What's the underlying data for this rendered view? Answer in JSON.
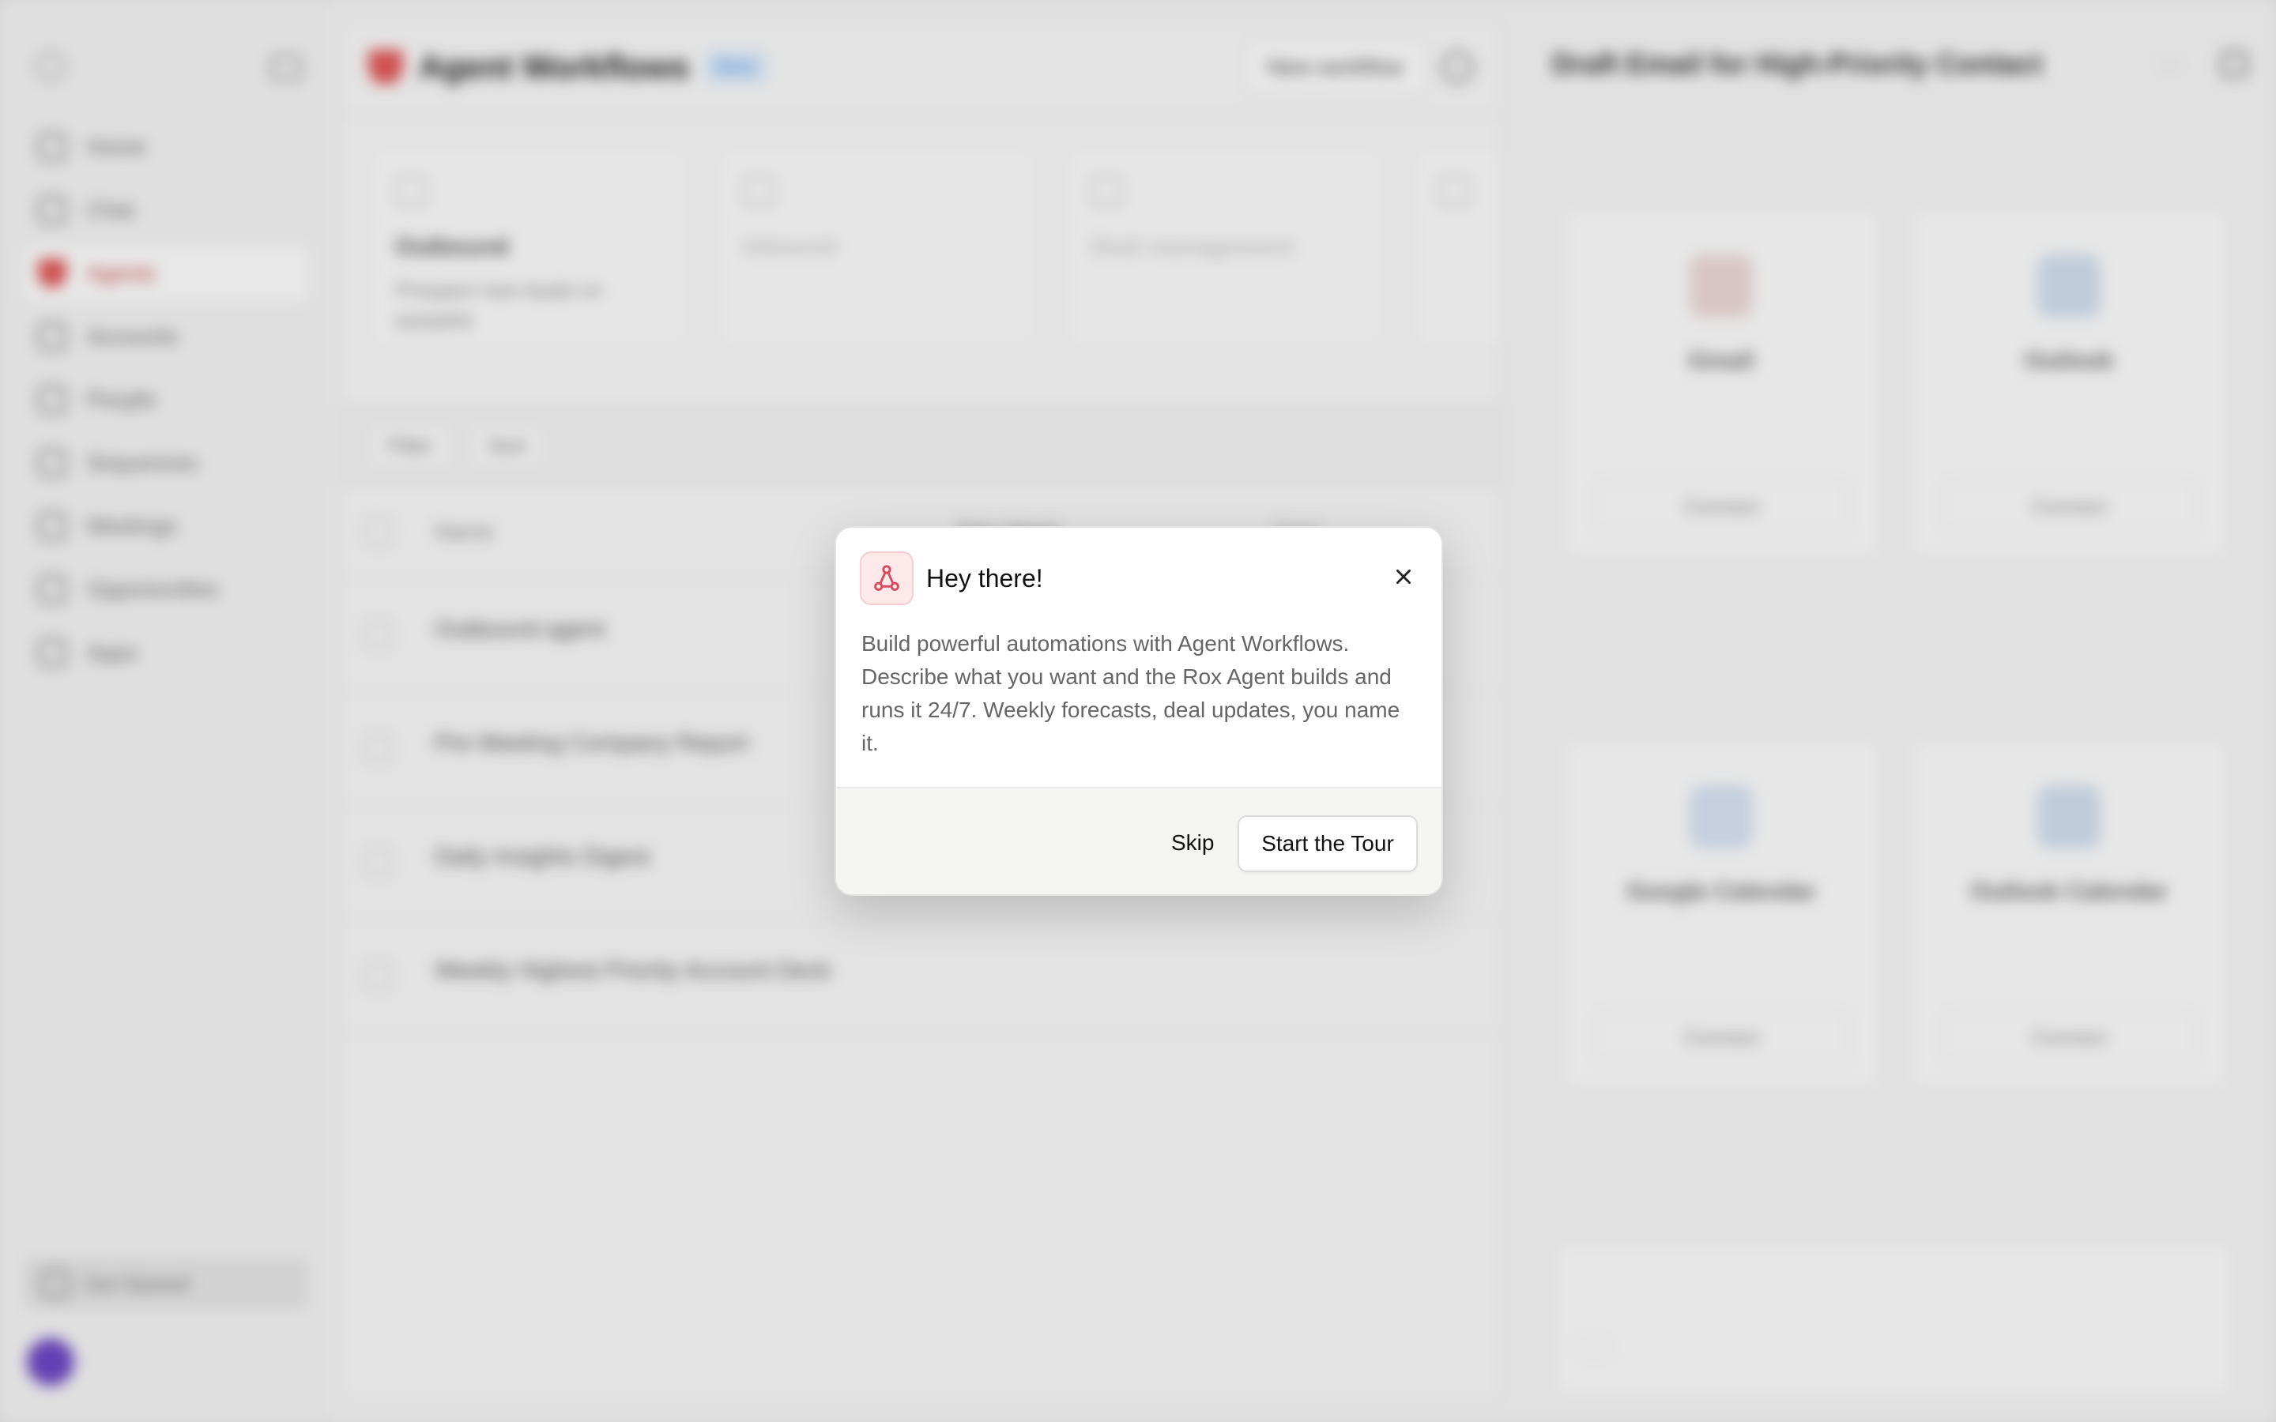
{
  "sidebar": {
    "workspace_name": "",
    "nav": [
      {
        "label": "Home"
      },
      {
        "label": "Chat"
      },
      {
        "label": "Agents"
      },
      {
        "label": "Accounts"
      },
      {
        "label": "People"
      },
      {
        "label": "Sequences"
      },
      {
        "label": "Meetings"
      },
      {
        "label": "Opportunities"
      },
      {
        "label": "Apps"
      }
    ],
    "active_item": "Agents",
    "get_started": "Get Started",
    "get_started_kbd": "",
    "user_name": "",
    "user_sub": ""
  },
  "main": {
    "title": "Agent Workflows",
    "badge": "Beta",
    "new_workflow": "New workflow",
    "cards": [
      {
        "title": "Outbound",
        "desc": "Prospect new leads on autopilot"
      },
      {
        "title": "Inbound",
        "desc": ""
      },
      {
        "title": "Deal management",
        "desc": ""
      },
      {
        "title": "",
        "desc": ""
      }
    ],
    "filter_label": "Filter",
    "sort_label": "Sort",
    "columns": {
      "name": "Name",
      "week": "This Week",
      "total": "Total"
    },
    "rows": [
      {
        "title": "Outbound agent",
        "desc": "",
        "week": "",
        "total": ""
      },
      {
        "title": "Pre Meeting Company Report",
        "desc": "",
        "week": "",
        "total": ""
      },
      {
        "title": "Daily Insights Digest",
        "desc": "",
        "week": "",
        "total": ""
      },
      {
        "title": "Weekly Highest Priority Account Deck",
        "desc": "",
        "week": "",
        "total": ""
      }
    ]
  },
  "panel": {
    "title": "Draft Email for High-Priority Contact",
    "email_section": "",
    "email_integrations": [
      {
        "name": "Gmail",
        "desc": "",
        "button": "Connect",
        "color": "#d93025"
      },
      {
        "name": "Outlook",
        "desc": "",
        "button": "Connect",
        "color": "#0f6cbd"
      }
    ],
    "message": "",
    "calendar_section": "",
    "calendar_integrations": [
      {
        "name": "Google Calendar",
        "desc": "",
        "button": "Connect",
        "color": "#4285f4"
      },
      {
        "name": "Outlook Calendar",
        "desc": "",
        "button": "Connect",
        "color": "#0f6cbd"
      }
    ],
    "input_placeholder": "",
    "accounts_chip": ""
  },
  "dialog": {
    "title": "Hey there!",
    "body": "Build powerful automations with Agent Workflows. Describe what you want and the Rox Agent builds and runs it 24/7. Weekly forecasts, deal updates, you name it.",
    "skip_label": "Skip",
    "start_label": "Start the Tour",
    "icon": "workflow-icon",
    "accent": "#d84a5a"
  }
}
